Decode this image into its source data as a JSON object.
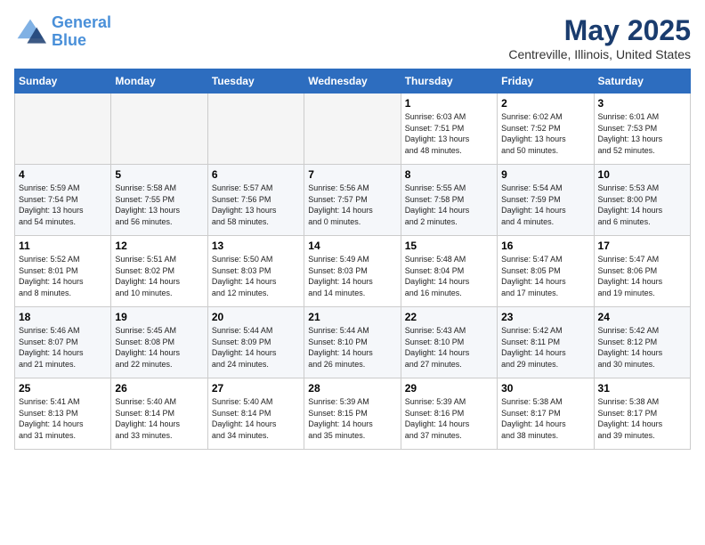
{
  "header": {
    "logo_line1": "General",
    "logo_line2": "Blue",
    "title": "May 2025",
    "subtitle": "Centreville, Illinois, United States"
  },
  "days_of_week": [
    "Sunday",
    "Monday",
    "Tuesday",
    "Wednesday",
    "Thursday",
    "Friday",
    "Saturday"
  ],
  "weeks": [
    [
      {
        "day": "",
        "info": ""
      },
      {
        "day": "",
        "info": ""
      },
      {
        "day": "",
        "info": ""
      },
      {
        "day": "",
        "info": ""
      },
      {
        "day": "1",
        "info": "Sunrise: 6:03 AM\nSunset: 7:51 PM\nDaylight: 13 hours\nand 48 minutes."
      },
      {
        "day": "2",
        "info": "Sunrise: 6:02 AM\nSunset: 7:52 PM\nDaylight: 13 hours\nand 50 minutes."
      },
      {
        "day": "3",
        "info": "Sunrise: 6:01 AM\nSunset: 7:53 PM\nDaylight: 13 hours\nand 52 minutes."
      }
    ],
    [
      {
        "day": "4",
        "info": "Sunrise: 5:59 AM\nSunset: 7:54 PM\nDaylight: 13 hours\nand 54 minutes."
      },
      {
        "day": "5",
        "info": "Sunrise: 5:58 AM\nSunset: 7:55 PM\nDaylight: 13 hours\nand 56 minutes."
      },
      {
        "day": "6",
        "info": "Sunrise: 5:57 AM\nSunset: 7:56 PM\nDaylight: 13 hours\nand 58 minutes."
      },
      {
        "day": "7",
        "info": "Sunrise: 5:56 AM\nSunset: 7:57 PM\nDaylight: 14 hours\nand 0 minutes."
      },
      {
        "day": "8",
        "info": "Sunrise: 5:55 AM\nSunset: 7:58 PM\nDaylight: 14 hours\nand 2 minutes."
      },
      {
        "day": "9",
        "info": "Sunrise: 5:54 AM\nSunset: 7:59 PM\nDaylight: 14 hours\nand 4 minutes."
      },
      {
        "day": "10",
        "info": "Sunrise: 5:53 AM\nSunset: 8:00 PM\nDaylight: 14 hours\nand 6 minutes."
      }
    ],
    [
      {
        "day": "11",
        "info": "Sunrise: 5:52 AM\nSunset: 8:01 PM\nDaylight: 14 hours\nand 8 minutes."
      },
      {
        "day": "12",
        "info": "Sunrise: 5:51 AM\nSunset: 8:02 PM\nDaylight: 14 hours\nand 10 minutes."
      },
      {
        "day": "13",
        "info": "Sunrise: 5:50 AM\nSunset: 8:03 PM\nDaylight: 14 hours\nand 12 minutes."
      },
      {
        "day": "14",
        "info": "Sunrise: 5:49 AM\nSunset: 8:03 PM\nDaylight: 14 hours\nand 14 minutes."
      },
      {
        "day": "15",
        "info": "Sunrise: 5:48 AM\nSunset: 8:04 PM\nDaylight: 14 hours\nand 16 minutes."
      },
      {
        "day": "16",
        "info": "Sunrise: 5:47 AM\nSunset: 8:05 PM\nDaylight: 14 hours\nand 17 minutes."
      },
      {
        "day": "17",
        "info": "Sunrise: 5:47 AM\nSunset: 8:06 PM\nDaylight: 14 hours\nand 19 minutes."
      }
    ],
    [
      {
        "day": "18",
        "info": "Sunrise: 5:46 AM\nSunset: 8:07 PM\nDaylight: 14 hours\nand 21 minutes."
      },
      {
        "day": "19",
        "info": "Sunrise: 5:45 AM\nSunset: 8:08 PM\nDaylight: 14 hours\nand 22 minutes."
      },
      {
        "day": "20",
        "info": "Sunrise: 5:44 AM\nSunset: 8:09 PM\nDaylight: 14 hours\nand 24 minutes."
      },
      {
        "day": "21",
        "info": "Sunrise: 5:44 AM\nSunset: 8:10 PM\nDaylight: 14 hours\nand 26 minutes."
      },
      {
        "day": "22",
        "info": "Sunrise: 5:43 AM\nSunset: 8:10 PM\nDaylight: 14 hours\nand 27 minutes."
      },
      {
        "day": "23",
        "info": "Sunrise: 5:42 AM\nSunset: 8:11 PM\nDaylight: 14 hours\nand 29 minutes."
      },
      {
        "day": "24",
        "info": "Sunrise: 5:42 AM\nSunset: 8:12 PM\nDaylight: 14 hours\nand 30 minutes."
      }
    ],
    [
      {
        "day": "25",
        "info": "Sunrise: 5:41 AM\nSunset: 8:13 PM\nDaylight: 14 hours\nand 31 minutes."
      },
      {
        "day": "26",
        "info": "Sunrise: 5:40 AM\nSunset: 8:14 PM\nDaylight: 14 hours\nand 33 minutes."
      },
      {
        "day": "27",
        "info": "Sunrise: 5:40 AM\nSunset: 8:14 PM\nDaylight: 14 hours\nand 34 minutes."
      },
      {
        "day": "28",
        "info": "Sunrise: 5:39 AM\nSunset: 8:15 PM\nDaylight: 14 hours\nand 35 minutes."
      },
      {
        "day": "29",
        "info": "Sunrise: 5:39 AM\nSunset: 8:16 PM\nDaylight: 14 hours\nand 37 minutes."
      },
      {
        "day": "30",
        "info": "Sunrise: 5:38 AM\nSunset: 8:17 PM\nDaylight: 14 hours\nand 38 minutes."
      },
      {
        "day": "31",
        "info": "Sunrise: 5:38 AM\nSunset: 8:17 PM\nDaylight: 14 hours\nand 39 minutes."
      }
    ]
  ]
}
